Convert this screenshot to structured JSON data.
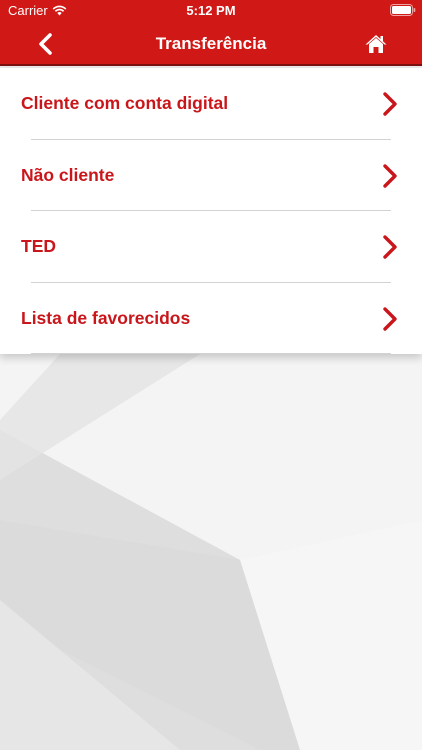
{
  "status_bar": {
    "carrier": "Carrier",
    "time": "5:12 PM",
    "wifi_icon": "wifi-icon",
    "battery_icon": "battery-icon"
  },
  "nav": {
    "title": "Transferência",
    "back_icon": "chevron-left-icon",
    "home_icon": "home-icon",
    "color": "#d01916"
  },
  "menu": {
    "accent_color": "#c9161a",
    "items": [
      {
        "label": "Cliente com conta digital",
        "icon": "chevron-right-icon"
      },
      {
        "label": "Não cliente",
        "icon": "chevron-right-icon"
      },
      {
        "label": "TED",
        "icon": "chevron-right-icon"
      },
      {
        "label": "Lista de favorecidos",
        "icon": "chevron-right-icon"
      }
    ]
  }
}
